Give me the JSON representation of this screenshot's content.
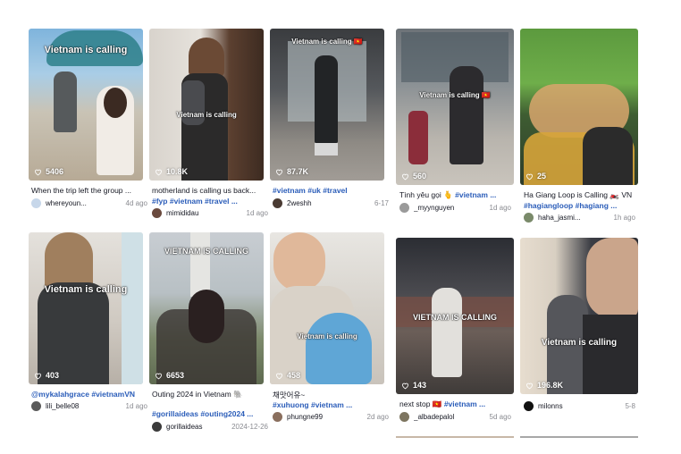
{
  "colors": {
    "hashtag": "#2b5db9",
    "date": "#8a8b91",
    "text": "#161823"
  },
  "icons": {
    "likes": "heart-outline-icon"
  },
  "videos": [
    {
      "overlay": "Vietnam is calling",
      "likes": "5406",
      "caption": "When the trip left the group ...",
      "tags": "",
      "author": "whereyoun...",
      "date": "4d ago"
    },
    {
      "overlay": "Vietnam is calling",
      "likes": "10.8K",
      "caption": "motherland is calling us back...",
      "tags": "#fyp #vietnam #travel ...",
      "author": "mimididau",
      "date": "1d ago"
    },
    {
      "overlay": "Vietnam is calling 🇻🇳",
      "likes": "87.7K",
      "caption": "",
      "tags": "#vietnam #uk #travel",
      "author": "2weshh",
      "date": "6-17"
    },
    {
      "overlay": "Vietnam is calling 🇻🇳",
      "likes": "560",
      "caption": "Tình yêu gọi 🫰",
      "tags": "#vietnam ...",
      "author": "_myynguyen",
      "date": "1d ago"
    },
    {
      "overlay": "",
      "likes": "25",
      "caption": "Ha Giang Loop is Calling 🏍️ VN",
      "tags": "#hagiangloop #hagiang ...",
      "author": "haha_jasmi...",
      "date": "1h ago"
    },
    {
      "overlay": "Vietnam is calling",
      "likes": "403",
      "caption": "",
      "tags": "@mykalahgrace #vietnamVN",
      "author": "lili_belle08",
      "date": "1d ago"
    },
    {
      "overlay": "VIETNAM IS CALLING",
      "likes": "6653",
      "caption": "Outing 2024 in Vietnam 🐘",
      "tags": "#gorillaideas #outing2024 ...",
      "author": "gorillaideas",
      "date": "2024-12-26"
    },
    {
      "overlay": "Vietnam is calling",
      "likes": "458",
      "caption": "채맛어유~",
      "tags": "#xuhuong #vietnam ...",
      "author": "phungne99",
      "date": "2d ago"
    },
    {
      "overlay": "VIETNAM IS CALLING",
      "likes": "143",
      "caption": "next stop 🇻🇳",
      "tags": "#vietnam ...",
      "author": "_albadepalol",
      "date": "5d ago"
    },
    {
      "overlay": "Vietnam is calling",
      "likes": "196.8K",
      "caption": "",
      "tags": "",
      "author": "milonns",
      "date": "5-8"
    }
  ]
}
